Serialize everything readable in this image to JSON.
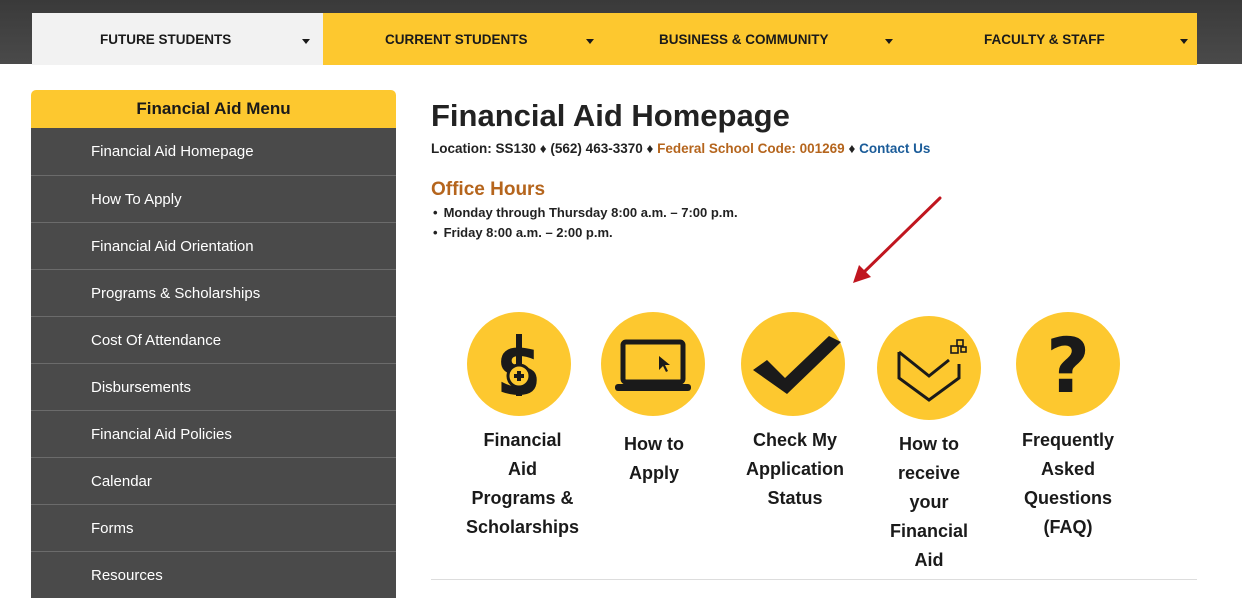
{
  "nav": {
    "items": [
      {
        "label": "FUTURE STUDENTS"
      },
      {
        "label": "CURRENT STUDENTS"
      },
      {
        "label": "BUSINESS & COMMUNITY"
      },
      {
        "label": "FACULTY & STAFF"
      }
    ]
  },
  "sidebar": {
    "title": "Financial Aid Menu",
    "items": [
      {
        "label": "Financial Aid Homepage"
      },
      {
        "label": "How To Apply"
      },
      {
        "label": "Financial Aid Orientation"
      },
      {
        "label": "Programs & Scholarships"
      },
      {
        "label": "Cost Of Attendance"
      },
      {
        "label": "Disbursements"
      },
      {
        "label": "Financial Aid Policies"
      },
      {
        "label": "Calendar"
      },
      {
        "label": "Forms"
      },
      {
        "label": "Resources"
      }
    ]
  },
  "main": {
    "title": "Financial Aid Homepage",
    "location_text": "Location: SS130 ♦ (562) 463-3370 ♦ ",
    "federal_code": "Federal School Code: 001269",
    "separator": " ♦ ",
    "contact": "Contact Us",
    "hours_title": "Office Hours",
    "hours": [
      "Monday  through Thursday  8:00 a.m. – 7:00 p.m.",
      "Friday 8:00 a.m. – 2:00 p.m."
    ]
  },
  "quicklinks": [
    {
      "icon": "dollar-icon",
      "lines": [
        "Financial",
        "Aid",
        "Programs &",
        "Scholarships"
      ]
    },
    {
      "icon": "laptop-icon",
      "lines": [
        "How to",
        "Apply"
      ]
    },
    {
      "icon": "checkmark-icon",
      "lines": [
        "Check My",
        "Application",
        "Status"
      ]
    },
    {
      "icon": "envelope-icon",
      "lines": [
        "How to",
        "receive",
        "your",
        "Financial",
        "Aid"
      ]
    },
    {
      "icon": "question-icon",
      "lines": [
        "Frequently",
        "Asked",
        "Questions",
        "(FAQ)"
      ]
    }
  ],
  "colors": {
    "accent": "#fdc82f",
    "sidebar_bg": "#4a4a4a",
    "office_hours": "#b5651d",
    "link": "#1b5c99",
    "arrow": "#c0161f"
  }
}
